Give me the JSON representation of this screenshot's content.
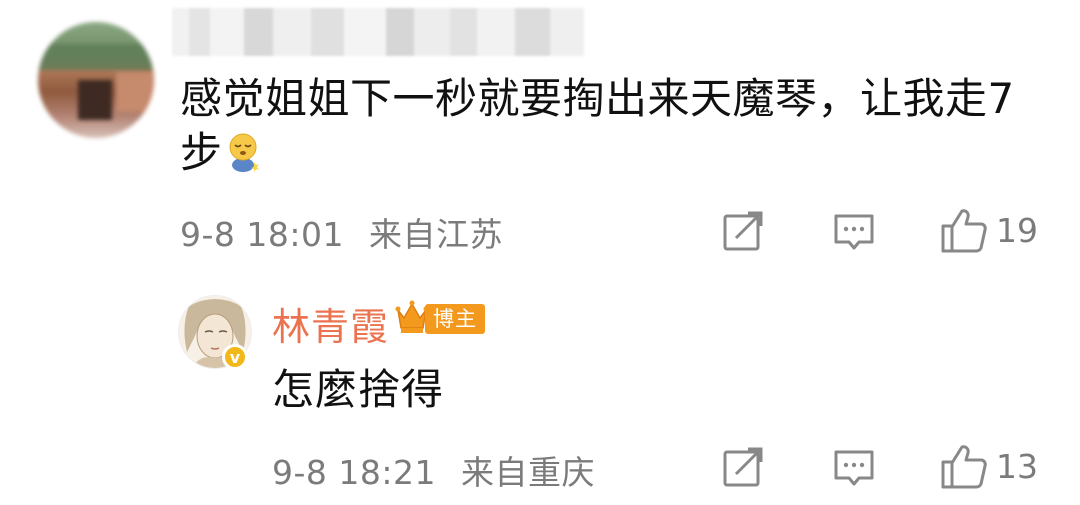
{
  "comments": [
    {
      "text_line1": "感觉姐姐下一秒就要掏出来天魔琴，让我走7",
      "text_line2": "步",
      "emoji": "sleepy-face-emoji",
      "timestamp": "9-8 18:01",
      "location": "来自江苏",
      "likes": "19"
    }
  ],
  "reply": {
    "author": "林青霞",
    "badge": "博主",
    "verified_mark": "v",
    "text": "怎麼捨得",
    "timestamp": "9-8 18:21",
    "location": "来自重庆",
    "likes": "13"
  },
  "colors": {
    "author_name": "#eb7350",
    "badge_bg": "#f39a1e",
    "meta_text": "#7b7b7b",
    "body_text": "#111111",
    "verified": "#f2b81a"
  },
  "icons": [
    "share-icon",
    "comment-icon",
    "like-icon",
    "crown-icon",
    "verified-icon"
  ]
}
